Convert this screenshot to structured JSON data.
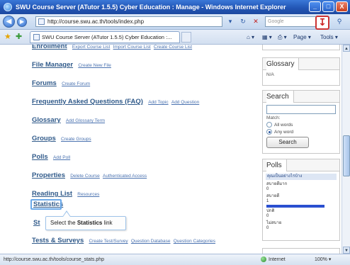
{
  "window": {
    "title": "SWU Course Server (ATutor 1.5.5) Cyber Education : Manage - Windows Internet Explorer",
    "minimize": "_",
    "maximize": "□",
    "close": "X"
  },
  "address": {
    "back": "◀",
    "forward": "▶",
    "url": "http://course.swu.ac.th/tools/index.php",
    "search_placeholder": "Google",
    "download_badge": "↧"
  },
  "tabs": {
    "active_tab": "SWU Course Server (ATutor 1.5.5) Cyber Education :...",
    "commands": [
      "Page ▾",
      "Tools ▾"
    ]
  },
  "menu": [
    {
      "title": "Enrollment",
      "subs": [
        "Export Course List",
        "Import Course List",
        "Create Course List"
      ]
    },
    {
      "title": "File Manager",
      "subs": [
        "Create New File"
      ]
    },
    {
      "title": "Forums",
      "subs": [
        "Create Forum"
      ]
    },
    {
      "title": "Frequently Asked Questions (FAQ)",
      "subs": [
        "Add Topic",
        "Add Question"
      ]
    },
    {
      "title": "Glossary",
      "subs": [
        "Add Glossary Term"
      ]
    },
    {
      "title": "Groups",
      "subs": [
        "Create Groups"
      ]
    },
    {
      "title": "Polls",
      "subs": [
        "Add Poll"
      ]
    },
    {
      "title": "Properties",
      "subs": [
        "Delete Course",
        "Authenticated Access"
      ]
    },
    {
      "title": "Reading List",
      "subs": [
        "Resources"
      ]
    },
    {
      "title": "Statistics",
      "subs": []
    },
    {
      "title": "St",
      "subs": []
    },
    {
      "title": "Tests & Surveys",
      "subs": [
        "Create Test/Survey",
        "Question Database",
        "Question Categories"
      ]
    }
  ],
  "callout": {
    "prefix": "Select the ",
    "bold": "Statistics",
    "suffix": " link"
  },
  "sidebar": {
    "glossary": {
      "title": "Glossary",
      "content": "N/A"
    },
    "search": {
      "title": "Search",
      "match_label": "Match:",
      "all_words": "All words",
      "any_word": "Any word",
      "button": "Search"
    },
    "polls": {
      "title": "Polls",
      "question": "คุณเป็นอย่างไรบ้าง",
      "options": [
        {
          "label": "สบายดีมาก",
          "count": "0",
          "fraction": 0
        },
        {
          "label": "สบายดี",
          "count": "1",
          "fraction": 1
        },
        {
          "label": "ปกติ",
          "count": "0",
          "fraction": 0
        },
        {
          "label": "ไม่สบาย",
          "count": "0",
          "fraction": 0
        }
      ]
    }
  },
  "status": {
    "url": "http://course.swu.ac.th/tools/course_stats.php",
    "zone": "Internet",
    "zoom": "100% ▾"
  }
}
